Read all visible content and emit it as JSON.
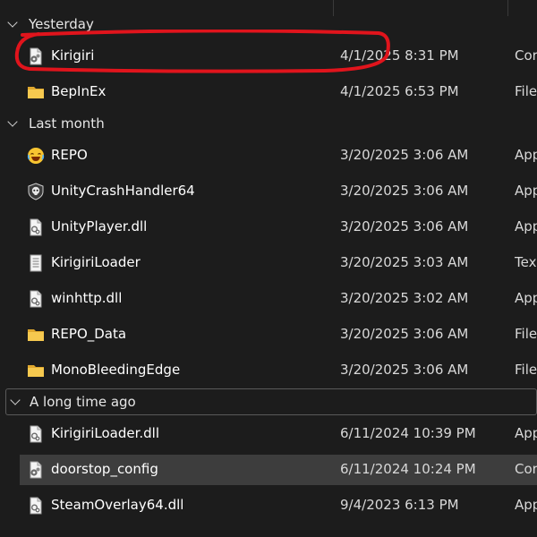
{
  "colors": {
    "background": "#1c1c1c",
    "text": "#ffffff",
    "secondary_text": "#d8d8d8",
    "selected_row": "#3d3d3d",
    "folder": "#f2c14e",
    "annotation": "#e0141c"
  },
  "groups": [
    {
      "label": "Yesterday",
      "items": [
        {
          "name": "Kirigiri",
          "date": "4/1/2025 8:31 PM",
          "type": "Cor",
          "icon": "config-settings-icon"
        },
        {
          "name": "BepInEx",
          "date": "4/1/2025 6:53 PM",
          "type": "File",
          "icon": "folder-icon"
        }
      ]
    },
    {
      "label": "Last month",
      "items": [
        {
          "name": "REPO",
          "date": "3/20/2025 3:06 AM",
          "type": "App",
          "icon": "laughing-emoji-icon"
        },
        {
          "name": "UnityCrashHandler64",
          "date": "3/20/2025 3:06 AM",
          "type": "App",
          "icon": "skull-shield-icon"
        },
        {
          "name": "UnityPlayer.dll",
          "date": "3/20/2025 3:06 AM",
          "type": "App",
          "icon": "dll-file-icon"
        },
        {
          "name": "KirigiriLoader",
          "date": "3/20/2025 3:03 AM",
          "type": "Tex",
          "icon": "text-file-icon"
        },
        {
          "name": "winhttp.dll",
          "date": "3/20/2025 3:02 AM",
          "type": "App",
          "icon": "dll-file-icon"
        },
        {
          "name": "REPO_Data",
          "date": "3/20/2025 3:06 AM",
          "type": "File",
          "icon": "folder-icon"
        },
        {
          "name": "MonoBleedingEdge",
          "date": "3/20/2025 3:06 AM",
          "type": "File",
          "icon": "folder-icon"
        }
      ]
    },
    {
      "label": "A long time ago",
      "items": [
        {
          "name": "KirigiriLoader.dll",
          "date": "6/11/2024 10:39 PM",
          "type": "App",
          "icon": "dll-file-icon"
        },
        {
          "name": "doorstop_config",
          "date": "6/11/2024 10:24 PM",
          "type": "Cor",
          "icon": "config-settings-icon",
          "selected": true
        },
        {
          "name": "SteamOverlay64.dll",
          "date": "9/4/2023 6:13 PM",
          "type": "App",
          "icon": "dll-file-icon"
        }
      ]
    }
  ]
}
